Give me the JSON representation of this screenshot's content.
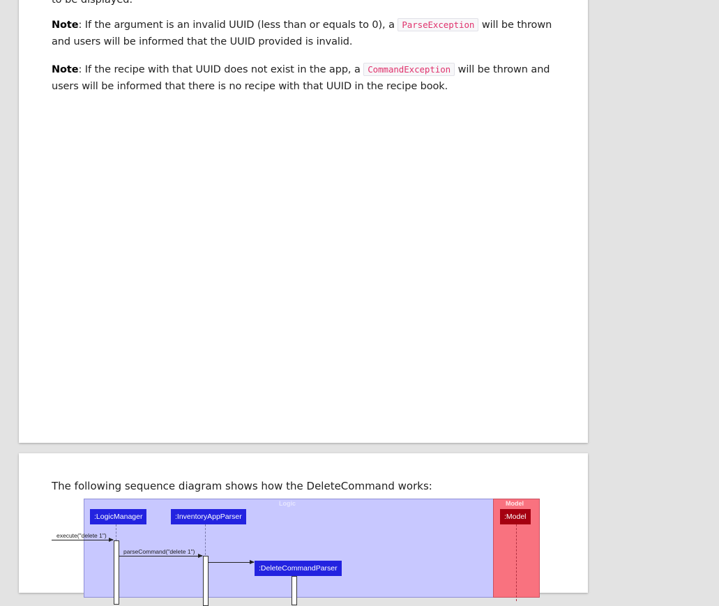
{
  "doc": {
    "cut_text": "to be displayed.",
    "note1": {
      "label": "Note",
      "text_a": ": If the argument is an invalid UUID (less than or equals to 0), a ",
      "code": "ParseException",
      "text_b": " will be thrown and users will be informed that the UUID provided is invalid."
    },
    "note2": {
      "label": "Note",
      "text_a": ": If the recipe with that UUID does not exist in the app, a ",
      "code": "CommandException",
      "text_b": " will be thrown and users will be informed that there is no recipe with that UUID in the recipe book."
    },
    "intro": "The following sequence diagram shows how the DeleteCommand works:"
  },
  "diagram": {
    "logic_title": "Logic",
    "model_title": "Model",
    "participants": {
      "logic_manager": ":LogicManager",
      "inventory_parser": ":InventoryAppParser",
      "delete_parser": ":DeleteCommandParser",
      "model": ":Model"
    },
    "messages": {
      "execute": "execute(\"delete 1\")",
      "parse_command": "parseCommand(\"delete 1\")"
    },
    "colors": {
      "logic_bg": "#c8c8ff",
      "model_bg": "#f9727f",
      "participant_blue": "#2323e0",
      "participant_red": "#a50010",
      "code_text": "#e0336d"
    }
  }
}
